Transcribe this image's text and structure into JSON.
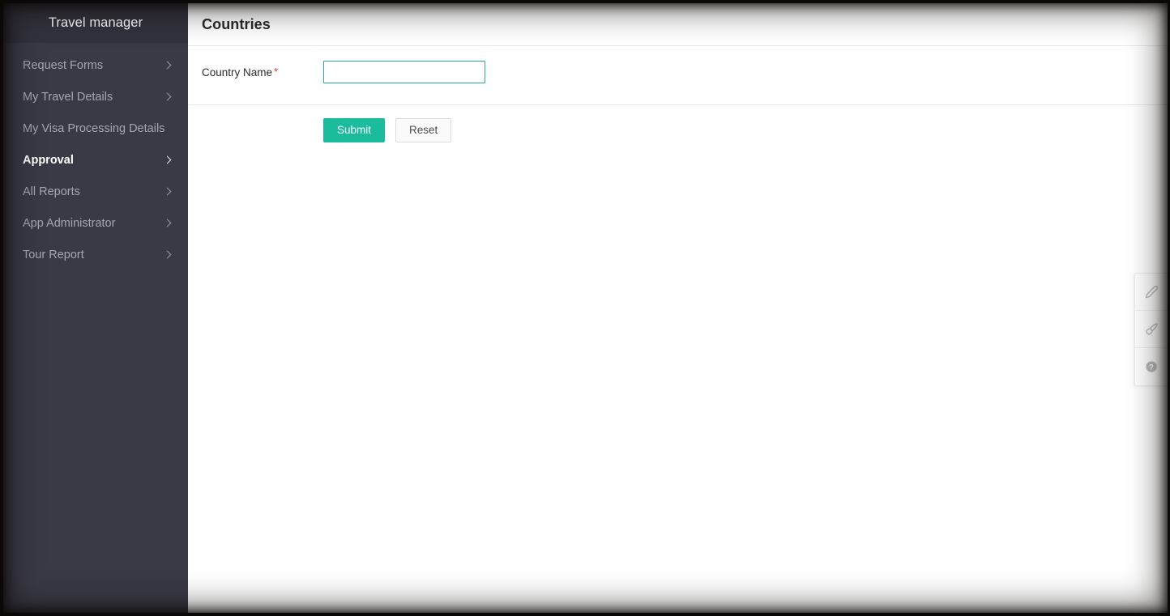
{
  "sidebar": {
    "brand": "Travel manager",
    "items": [
      {
        "label": "Request Forms",
        "has_chevron": true,
        "active": false
      },
      {
        "label": "My Travel Details",
        "has_chevron": true,
        "active": false
      },
      {
        "label": "My Visa Processing Details",
        "has_chevron": false,
        "active": false
      },
      {
        "label": "Approval",
        "has_chevron": true,
        "active": true
      },
      {
        "label": "All Reports",
        "has_chevron": true,
        "active": false
      },
      {
        "label": "App Administrator",
        "has_chevron": true,
        "active": false
      },
      {
        "label": "Tour Report",
        "has_chevron": true,
        "active": false
      }
    ]
  },
  "header": {
    "title": "Countries"
  },
  "form": {
    "fields": [
      {
        "label": "Country Name",
        "required_mark": "*",
        "value": "",
        "placeholder": "",
        "focused": true
      }
    ]
  },
  "actions": {
    "submit_label": "Submit",
    "reset_label": "Reset"
  },
  "tool_rail": {
    "buttons": [
      {
        "icon": "pencil-icon"
      },
      {
        "icon": "paintbrush-icon"
      },
      {
        "icon": "help-circle-icon"
      }
    ]
  },
  "colors": {
    "sidebar_bg": "#3A3A47",
    "sidebar_header_bg": "#32323E",
    "sidebar_text": "#A6A6B3",
    "sidebar_active_text": "#FFFFFF",
    "accent_teal": "#1ABC9C",
    "input_focus_border": "#2FA894",
    "required_red": "#E03131",
    "divider": "#E7E7E9",
    "page_bg": "#FFFFFF"
  }
}
